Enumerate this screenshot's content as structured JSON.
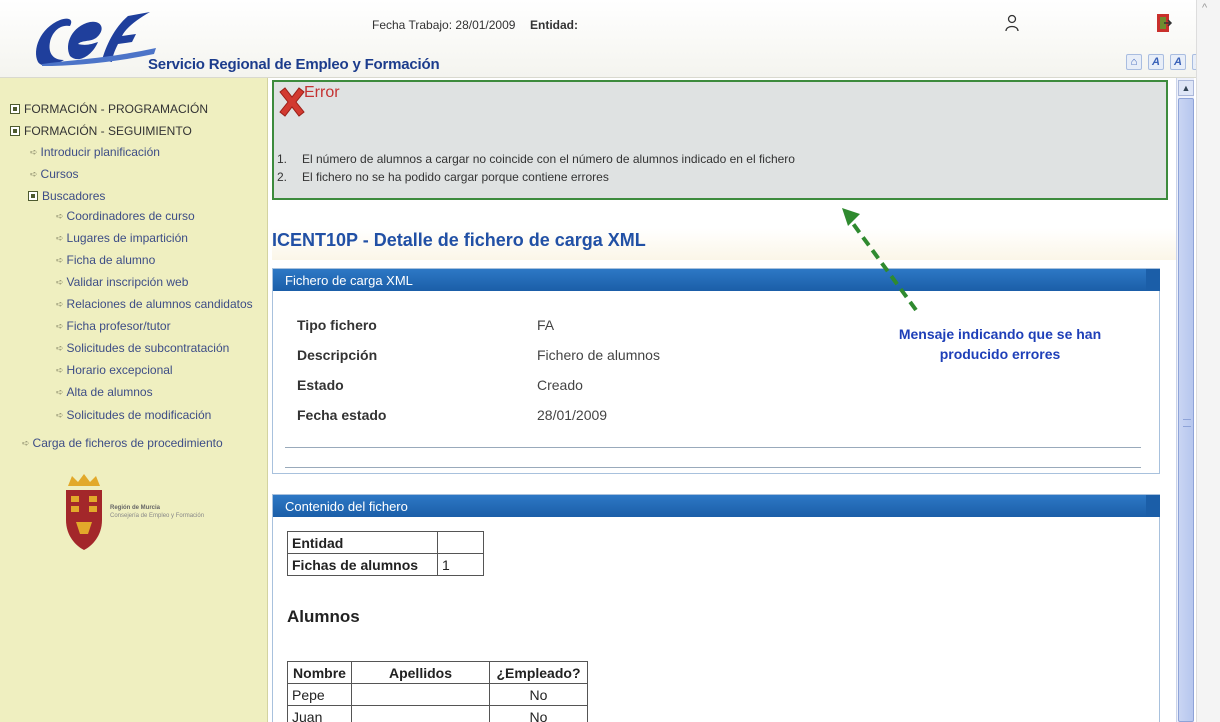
{
  "header": {
    "org_name": "Servicio Regional de Empleo y Formación",
    "fecha_label": "Fecha Trabajo:",
    "fecha_value": "28/01/2009",
    "entidad_label": "Entidad:",
    "tool_icons": [
      "A",
      "A",
      "A"
    ]
  },
  "sidebar": {
    "sections": [
      {
        "label": "FORMACIÓN - PROGRAMACIÓN"
      },
      {
        "label": "FORMACIÓN - SEGUIMIENTO"
      }
    ],
    "items": [
      {
        "label": "Introducir planificación"
      },
      {
        "label": "Cursos"
      }
    ],
    "buscadores_label": "Buscadores",
    "buscadores_items": [
      {
        "label": "Coordinadores de curso"
      },
      {
        "label": "Lugares de impartición"
      },
      {
        "label": "Ficha de alumno"
      },
      {
        "label": "Validar inscripción web"
      },
      {
        "label": "Relaciones de alumnos candidatos"
      },
      {
        "label": "Ficha profesor/tutor"
      },
      {
        "label": "Solicitudes de subcontratación"
      },
      {
        "label": "Horario excepcional"
      },
      {
        "label": "Alta de alumnos"
      },
      {
        "label": "Solicitudes de modificación"
      }
    ],
    "carga_label": "Carga de ficheros de procedimiento",
    "region_title": "Región de Murcia",
    "region_subtitle": "Consejería de Empleo y Formación"
  },
  "error": {
    "title": "Error",
    "messages": [
      {
        "num": "1.",
        "text": "El número de alumnos a cargar no coincide con el número de alumnos indicado en el fichero"
      },
      {
        "num": "2.",
        "text": "El fichero no se ha podido cargar porque contiene errores"
      }
    ]
  },
  "page_title": "ICENT10P - Detalle de fichero de carga XML",
  "panel1": {
    "header": "Fichero de carga XML",
    "rows": [
      {
        "label": "Tipo fichero",
        "value": "FA"
      },
      {
        "label": "Descripción",
        "value": "Fichero de alumnos"
      },
      {
        "label": "Estado",
        "value": "Creado"
      },
      {
        "label": "Fecha estado",
        "value": "28/01/2009"
      }
    ]
  },
  "annotation": {
    "line1": "Mensaje indicando que se han",
    "line2": "producido errores"
  },
  "panel2": {
    "header": "Contenido del fichero",
    "entidad_label": "Entidad",
    "entidad_value": "",
    "fichas_label": "Fichas de alumnos",
    "fichas_value": "1",
    "alumnos_title": "Alumnos",
    "columns": [
      "Nombre",
      "Apellidos",
      "¿Empleado?"
    ],
    "rows": [
      {
        "nombre": "Pepe",
        "apellidos": "",
        "empleado": "No"
      },
      {
        "nombre": "Juan",
        "apellidos": "",
        "empleado": "No"
      }
    ]
  },
  "colors": {
    "sidebar_bg": "#efefc0",
    "panel_header": "#1b5ea8",
    "error_border": "#3d8b3d",
    "annotation": "#1e3fb8"
  }
}
